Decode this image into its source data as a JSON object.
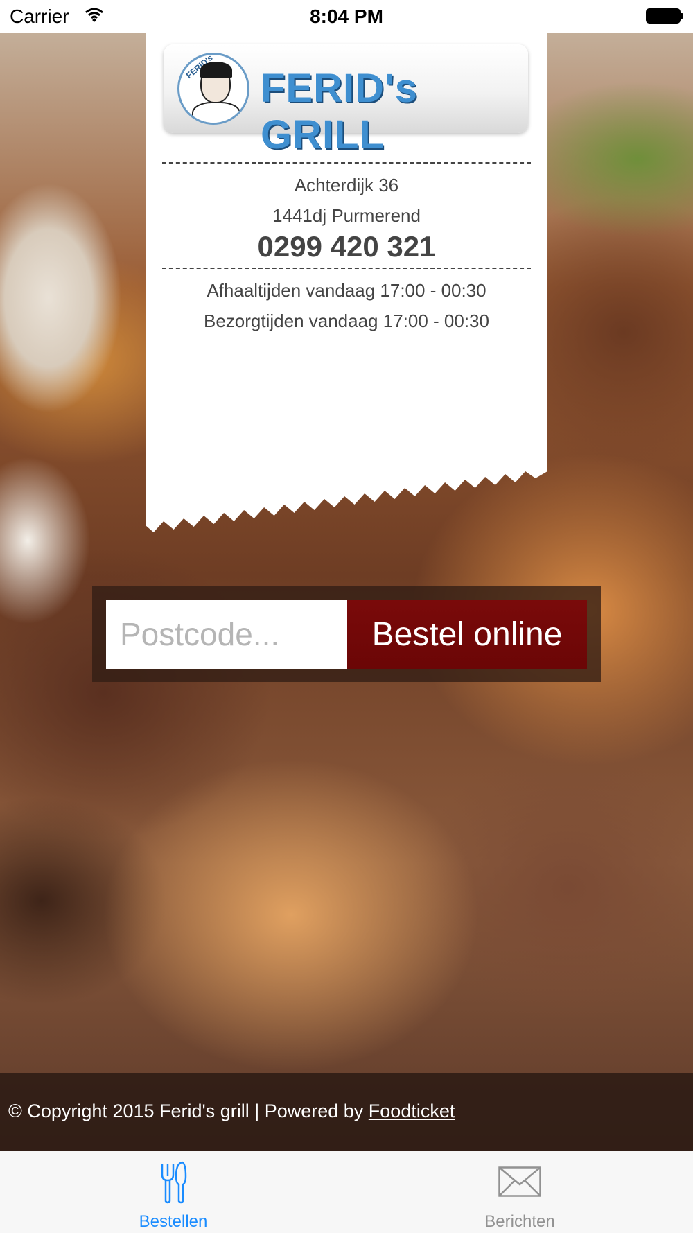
{
  "status_bar": {
    "carrier": "Carrier",
    "time": "8:04 PM"
  },
  "restaurant": {
    "logo_text": "FERID's GRILL",
    "address_line1": "Achterdijk 36",
    "address_line2": "1441dj Purmerend",
    "phone": "0299 420 321",
    "pickup_hours": "Afhaaltijden vandaag 17:00 - 00:30",
    "delivery_hours": "Bezorgtijden vandaag 17:00 - 00:30"
  },
  "order": {
    "postcode_placeholder": "Postcode...",
    "postcode_value": "",
    "order_button_label": "Bestel online"
  },
  "footer": {
    "copyright_text": "© Copyright 2015 Ferid's grill | Powered by ",
    "link_text": "Foodticket"
  },
  "tabbar": {
    "tabs": [
      {
        "label": "Bestellen",
        "icon": "fork-knife-icon",
        "active": true
      },
      {
        "label": "Berichten",
        "icon": "envelope-icon",
        "active": false
      }
    ]
  },
  "colors": {
    "order_button": "#6b0606",
    "active_tab": "#1a8cff",
    "inactive_tab": "#929292"
  }
}
